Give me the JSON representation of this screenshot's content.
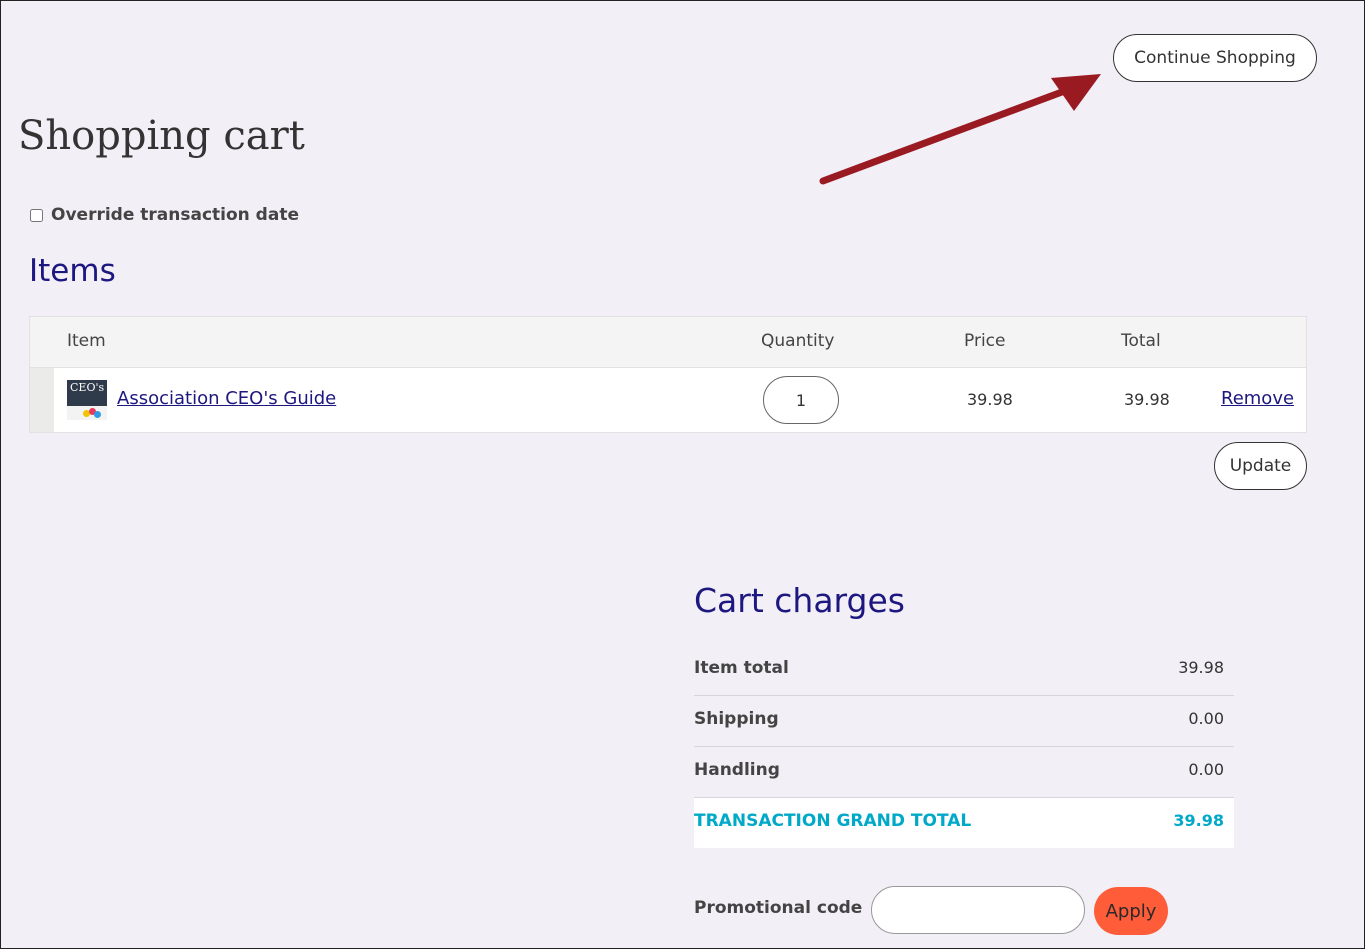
{
  "header": {
    "continue_label": "Continue Shopping",
    "page_title": "Shopping cart"
  },
  "override": {
    "label": "Override transaction date",
    "checked": false
  },
  "items_section": {
    "title": "Items",
    "columns": {
      "item": "Item",
      "quantity": "Quantity",
      "price": "Price",
      "total": "Total"
    },
    "rows": [
      {
        "thumbnail_text": "CEO's",
        "name": "Association CEO's Guide",
        "quantity": "1",
        "price": "39.98",
        "total": "39.98",
        "remove_label": "Remove"
      }
    ],
    "update_label": "Update"
  },
  "charges": {
    "title": "Cart charges",
    "rows": [
      {
        "label": "Item total",
        "value": "39.98"
      },
      {
        "label": "Shipping",
        "value": "0.00"
      },
      {
        "label": "Handling",
        "value": "0.00"
      }
    ],
    "grand_total": {
      "label": "TRANSACTION GRAND TOTAL",
      "value": "39.98"
    }
  },
  "promo": {
    "label": "Promotional code",
    "value": "",
    "apply_label": "Apply"
  },
  "colors": {
    "background": "#f2eff6",
    "heading": "#1d1780",
    "grand_total": "#00a9c8",
    "apply_button": "#ff5c39",
    "annotation_arrow": "#9a1a22"
  }
}
